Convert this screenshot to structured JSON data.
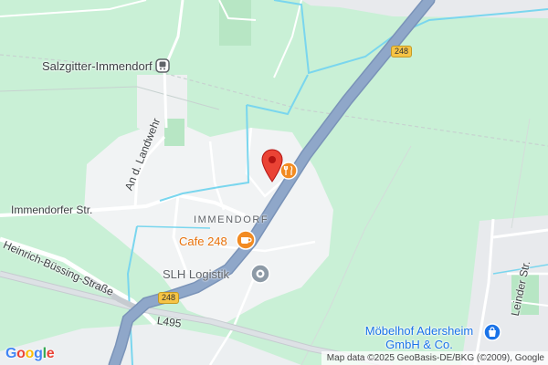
{
  "map": {
    "places": {
      "town_label": "Salzgitter-Immendorf",
      "district_label": "IMMENDORF"
    },
    "streets": {
      "immendorfer": "Immendorfer Str.",
      "landwehr": "An d. Landwehr",
      "buessing": "Heinrich-Büssing-Straße",
      "leinder": "Leinder Str.",
      "l495": "L495"
    },
    "road_shields": {
      "b248_top": "248",
      "b248_bottom": "248"
    },
    "pois": {
      "cafe": "Cafe 248",
      "logistik": "SLH Logistik",
      "moebel_line1": "Möbelhof Adersheim",
      "moebel_line2": "GmbH & Co."
    },
    "branding": {
      "logo": "Google"
    },
    "attribution": "Map data ©2025 GeoBasis-DE/BKG (©2009), Google",
    "colors": {
      "park_green": "#c9f0d6",
      "urban_grey": "#f1f3f4",
      "highway_blue": "#8fa7c9",
      "water_cyan": "#7ad6ee",
      "pin_red": "#ea4335",
      "food_orange": "#f28b22",
      "shop_blue": "#1a73e8",
      "shield_yellow": "#f6c445"
    },
    "icons": [
      "train-station-icon",
      "restaurant-icon",
      "cafe-icon",
      "business-icon",
      "shopping-icon",
      "location-pin-icon"
    ]
  }
}
